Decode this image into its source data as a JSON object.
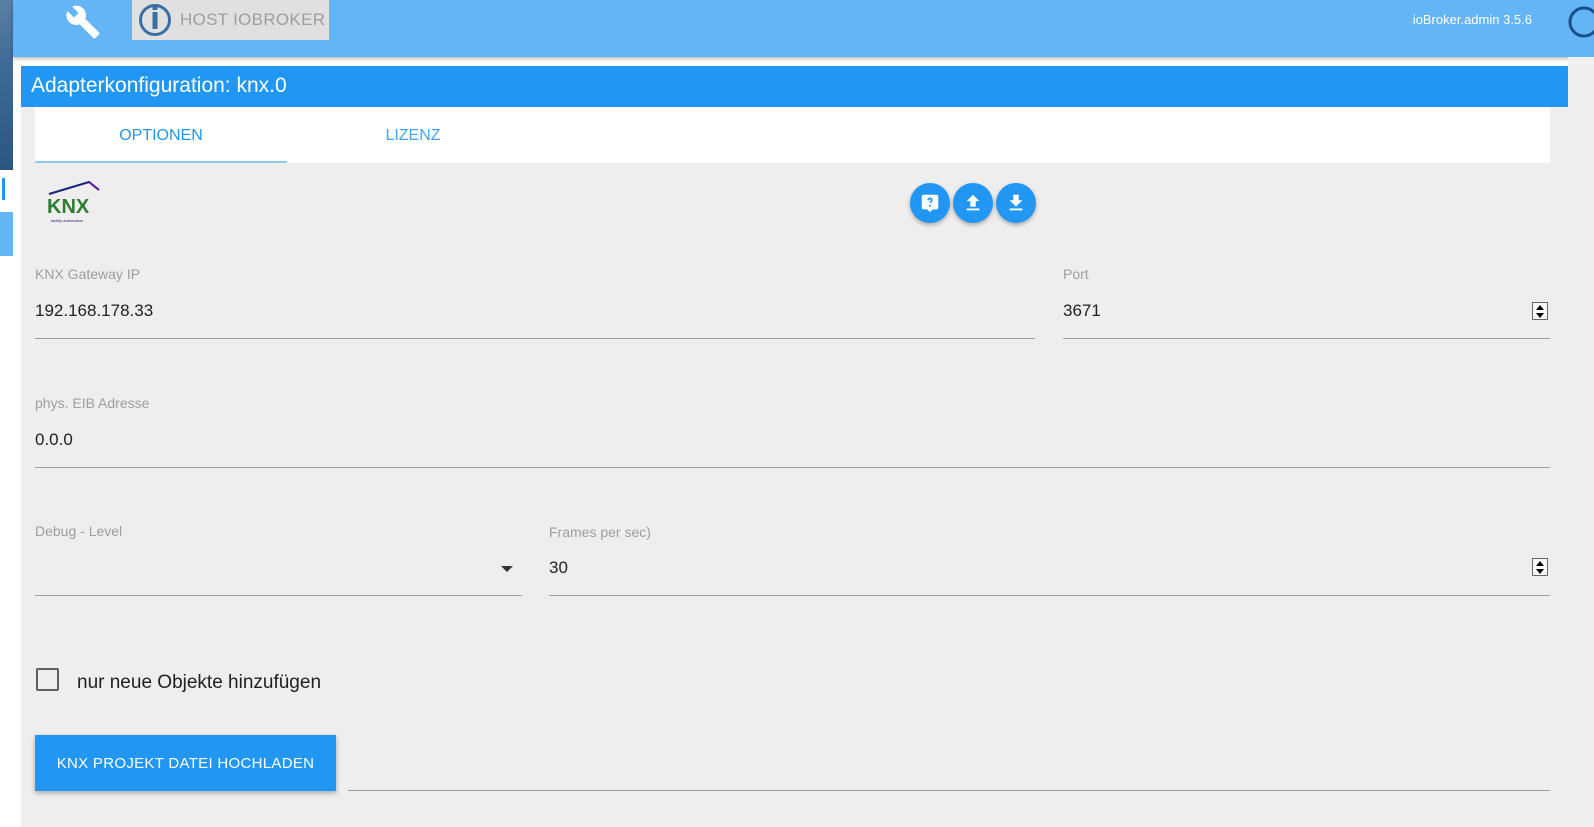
{
  "topbar": {
    "host_label": "HOST IOBROKER",
    "version": "ioBroker.admin 3.5.6",
    "background": "#64b5f6"
  },
  "dialog": {
    "title": "Adapterkonfiguration: knx.0",
    "accent": "#2196f3"
  },
  "tabs": [
    {
      "label": "OPTIONEN",
      "active": true
    },
    {
      "label": "LIZENZ",
      "active": false
    }
  ],
  "logo": {
    "text": "KNX",
    "subtitle": "facility automation"
  },
  "actions": {
    "icons": [
      "help-icon",
      "upload-icon",
      "download-icon"
    ]
  },
  "fields": {
    "gateway_ip": {
      "label": "KNX Gateway IP",
      "value": "192.168.178.33"
    },
    "port": {
      "label": "Port",
      "value": "3671"
    },
    "eib_address": {
      "label": "phys. EIB Adresse",
      "value": "0.0.0"
    },
    "debug_level": {
      "label": "Debug - Level",
      "value": ""
    },
    "frames_per_sec": {
      "label": "Frames per sec)",
      "value": "30"
    }
  },
  "checkbox": {
    "label": "nur neue Objekte hinzufügen",
    "checked": false
  },
  "upload": {
    "button_label": "KNX PROJEKT DATEI HOCHLADEN"
  }
}
